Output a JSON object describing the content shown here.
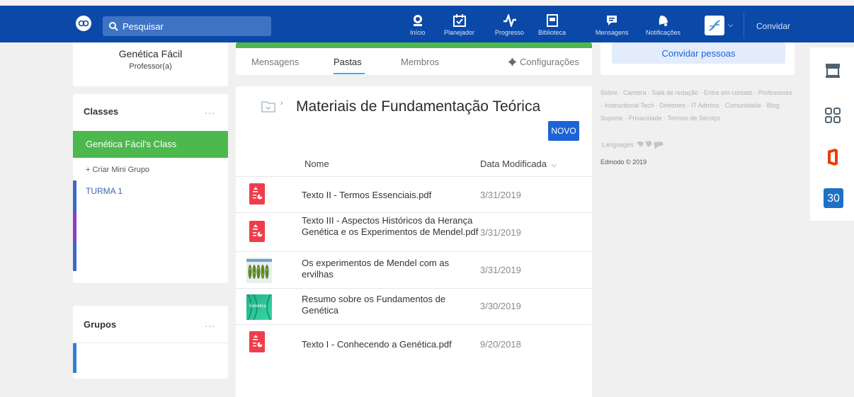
{
  "header": {
    "search_placeholder": "Pesquisar",
    "nav": [
      {
        "label": "Início",
        "icon": "home-icon"
      },
      {
        "label": "Planejador",
        "icon": "planner-icon"
      },
      {
        "label": "Progresso",
        "icon": "progress-icon"
      },
      {
        "label": "Biblioteca",
        "icon": "library-icon"
      },
      {
        "label": "Mensagens",
        "icon": "messages-icon"
      },
      {
        "label": "Notificações",
        "icon": "notifications-icon"
      }
    ],
    "invite_label": "Convidar"
  },
  "profile": {
    "name": "Genética Fácil",
    "role": "Professor(a)"
  },
  "classes": {
    "title": "Classes",
    "menu_dots": "...",
    "active_class": "Genética Fácil's Class",
    "create_group": "+ Criar Mini Grupo",
    "items": [
      {
        "label": "TURMA 1",
        "color": "#3b6ac4"
      },
      {
        "label": "",
        "color": "#8a3fc4"
      },
      {
        "label": "",
        "color": "#3b6ac4"
      }
    ]
  },
  "groups": {
    "title": "Grupos",
    "menu_dots": "...",
    "bar_color": "#2f7fd8"
  },
  "tabs": {
    "items": [
      "Mensagens",
      "Pastas",
      "Membros"
    ],
    "active": "Pastas",
    "settings_label": "Configurações"
  },
  "folder": {
    "title": "Materiais de Fundamentação Teórica",
    "new_button": "NOVO",
    "col_name": "Nome",
    "col_date": "Data Modificada",
    "files": [
      {
        "name": "Texto II - Termos Essenciais.pdf",
        "date": "3/31/2019",
        "type": "pdf"
      },
      {
        "name": "Texto III - Aspectos Históricos da Herança Genética e os Experimentos de Mendel.pdf",
        "date": "3/31/2019",
        "type": "pdf"
      },
      {
        "name": "Os experimentos de Mendel com as ervilhas",
        "date": "3/31/2019",
        "type": "image-peas"
      },
      {
        "name": "Resumo sobre os Fundamentos de Genética",
        "date": "3/30/2019",
        "type": "image-genetica"
      },
      {
        "name": "Texto I - Conhecendo a Genética.pdf",
        "date": "9/20/2018",
        "type": "pdf"
      }
    ],
    "thumb_text": "Genética"
  },
  "right": {
    "invite_people": "Convidar pessoas",
    "footer_links": "Sobre · Carreira · Sala de redação · Entre em contato · Professores · Instructional Tech · Diretores · IT Admins · Comunidade · Blog · Suporte · Privacidade · Termos de Serviço ·",
    "languages": "Languages",
    "copyright": "Edmodo © 2019"
  },
  "side_apps": [
    {
      "icon": "store-icon"
    },
    {
      "icon": "apps-grid-icon"
    },
    {
      "icon": "office-icon"
    },
    {
      "icon": "calendar-icon",
      "label": "30"
    }
  ]
}
